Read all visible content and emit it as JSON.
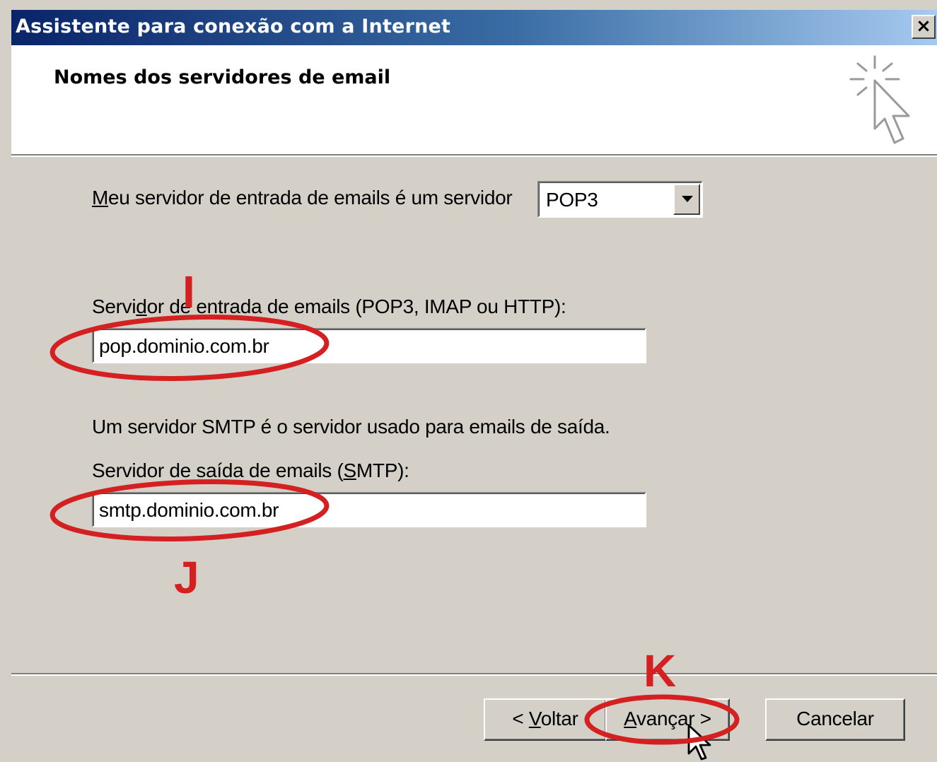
{
  "window": {
    "title": "Assistente para conexão com a Internet",
    "close_symbol": "×"
  },
  "header": {
    "page_title": "Nomes dos servidores de email",
    "icon": "wizard-cursor-sparkle-icon"
  },
  "incoming_server_type": {
    "label_mnemonic": "M",
    "label_rest": "eu servidor de entrada de emails é um  servidor",
    "selected": "POP3"
  },
  "incoming_server": {
    "label_pre": "Servi",
    "label_mnemonic": "d",
    "label_post": "or de entrada de emails (POP3, IMAP ou HTTP):",
    "value": "pop.dominio.com.br"
  },
  "smtp_info": {
    "text": "Um servidor SMTP é o servidor usado para emails de saída."
  },
  "outgoing_server": {
    "label_pre": "Servidor de saída de emails (",
    "label_mnemonic": "S",
    "label_post": "MTP):",
    "value": "smtp.dominio.com.br"
  },
  "buttons": {
    "back_pre": "< ",
    "back_mnemonic": "V",
    "back_post": "oltar",
    "next_mnemonic": "A",
    "next_post": "vançar >",
    "cancel": "Cancelar"
  },
  "annotations": {
    "letters": [
      "I",
      "J",
      "K"
    ],
    "color": "#d42020"
  }
}
